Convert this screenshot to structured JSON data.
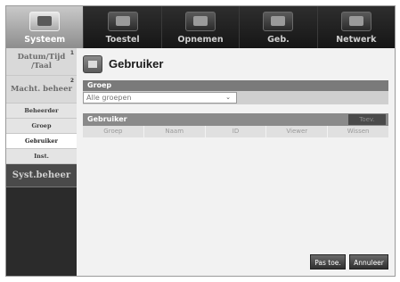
{
  "nav": {
    "tabs": [
      {
        "label": "Systeem",
        "icon": "system-icon",
        "active": true
      },
      {
        "label": "Toestel",
        "icon": "camera-icon",
        "active": false
      },
      {
        "label": "Opnemen",
        "icon": "rec-icon",
        "active": false
      },
      {
        "label": "Geb.",
        "icon": "event-icon",
        "active": false
      },
      {
        "label": "Netwerk",
        "icon": "network-icon",
        "active": false
      }
    ]
  },
  "sidebar": {
    "items": [
      {
        "label": "Datum/Tijd /Taal",
        "num": "1"
      },
      {
        "label": "Macht. beheer",
        "num": "2"
      },
      {
        "label": "Beheerder"
      },
      {
        "label": "Groep"
      },
      {
        "label": "Gebruiker"
      },
      {
        "label": "Inst."
      },
      {
        "label": "Syst.beheer"
      }
    ]
  },
  "main": {
    "title": "Gebruiker",
    "group_header": "Groep",
    "group_select": {
      "value": "Alle groepen",
      "chevron": "⌄"
    },
    "user_header": "Gebruiker",
    "add_button": "Toev.",
    "columns": [
      "Groep",
      "Naam",
      "ID",
      "Viewer",
      "Wissen"
    ],
    "apply_button": "Pas toe.",
    "cancel_button": "Annuleer"
  },
  "colors": {
    "nav_bg": "#1d1d1d",
    "sidebar_bg": "#2b2b2b",
    "header_bar": "#7a7a7a"
  }
}
